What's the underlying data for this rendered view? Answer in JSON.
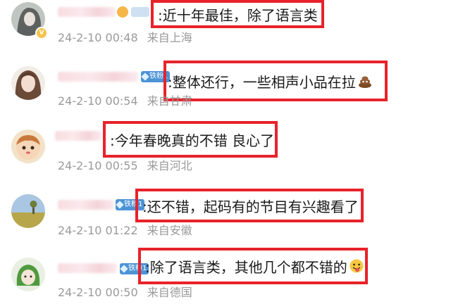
{
  "comments": [
    {
      "text": ":近十年最佳，除了语言类",
      "timestamp": "24-2-10 00:48",
      "location": "来自上海",
      "badge": "",
      "verified_icon": "verified-v-icon",
      "emoji": ""
    },
    {
      "text": ":整体还行，一些相声小品在拉",
      "timestamp": "24-2-10 00:54",
      "location": "来自甘肃",
      "badge": "铁粉1",
      "emoji": "poop-emoji-icon"
    },
    {
      "text": ":今年春晚真的不错  良心了",
      "timestamp": "24-2-10 00:55",
      "location": "来自河北",
      "badge": "",
      "emoji": ""
    },
    {
      "text": ":还不错，起码有的节目有兴趣看了",
      "timestamp": "24-2-10 01:22",
      "location": "来自安徽",
      "badge": "铁粉1",
      "emoji": ""
    },
    {
      "text": ":除了语言类，其他几个都不错的",
      "timestamp": "24-2-10 00:50",
      "location": "来自德国",
      "badge": "铁粉1",
      "emoji": "tongue-out-emoji-icon"
    }
  ],
  "colors": {
    "highlight_box": "#e8222a",
    "meta_text": "#9a9a9a",
    "badge_blue": "#4c93d6"
  }
}
